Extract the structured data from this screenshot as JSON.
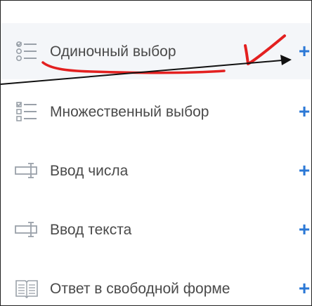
{
  "items": [
    {
      "label": "Одиночный выбор",
      "icon": "single-choice-list-icon",
      "selected": true
    },
    {
      "label": "Множественный выбор",
      "icon": "multiple-choice-list-icon",
      "selected": false
    },
    {
      "label": "Ввод числа",
      "icon": "number-input-icon",
      "selected": false
    },
    {
      "label": "Ввод текста",
      "icon": "text-input-icon",
      "selected": false
    },
    {
      "label": "Ответ в свободной форме",
      "icon": "free-form-answer-icon",
      "selected": false
    }
  ],
  "add_label": "+",
  "colors": {
    "accent": "#2b78d6",
    "annotation_red": "#e32020",
    "annotation_arrow": "#111111",
    "icon_gray": "#9aa1a9",
    "text": "#4a4a4a",
    "selected_bg": "#f4f6f9"
  }
}
